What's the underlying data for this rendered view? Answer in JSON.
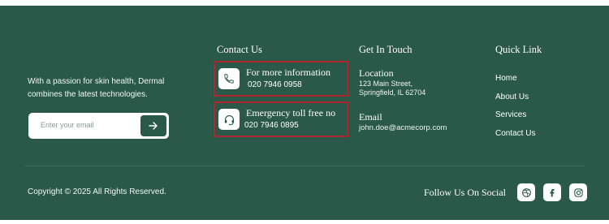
{
  "about": {
    "tagline": "With a passion for skin health, Dermal combines the latest technologies.",
    "email_placeholder": "Enter your email",
    "submit_icon": "arrow-right-icon"
  },
  "contact": {
    "title": "Contact Us",
    "cards": [
      {
        "icon": "phone-icon",
        "heading": "For more information",
        "number": "020 7946 0958"
      },
      {
        "icon": "headset-icon",
        "heading": "Emergency toll free no",
        "number": "020 7946 0895"
      }
    ]
  },
  "get_in_touch": {
    "title": "Get In Touch",
    "location_label": "Location",
    "location_line1": "123 Main Street,",
    "location_line2": "Springfield, IL 62704",
    "email_label": "Email",
    "email_value": "john.doe@acmecorp.com"
  },
  "quick_links": {
    "title": "Quick Link",
    "items": [
      "Home",
      "About Us",
      "Services",
      "Contact Us"
    ]
  },
  "bottom": {
    "copyright": "Copyright © 2025 All Rights Reserved.",
    "follow_label": "Follow Us On Social",
    "social_icons": [
      "dribbble-icon",
      "facebook-icon",
      "instagram-icon"
    ]
  },
  "colors": {
    "footer_bg": "#2a5849",
    "card_border": "#b0262e",
    "text": "#ffffff"
  }
}
